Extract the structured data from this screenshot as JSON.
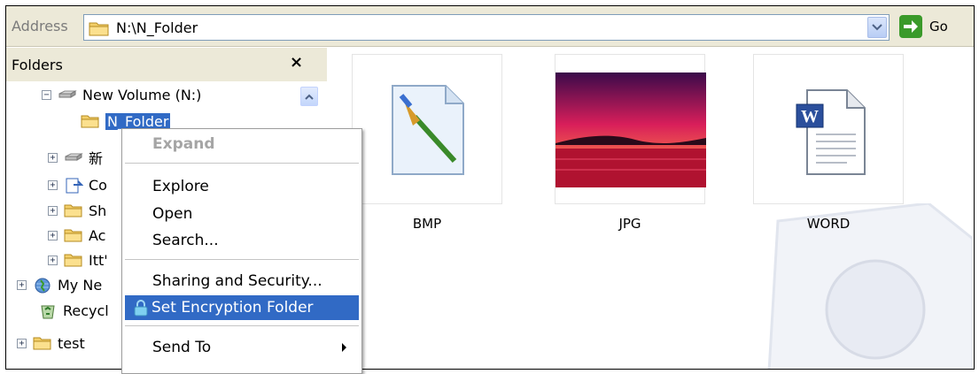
{
  "address": {
    "label": "Address",
    "path": "N:\\N_Folder",
    "go_label": "Go"
  },
  "folders_pane": {
    "title": "Folders",
    "close": "×"
  },
  "tree": [
    {
      "expander": "−",
      "icon": "drive-icon",
      "label": "New Volume (N:)"
    },
    {
      "expander": "",
      "icon": "folder-icon",
      "label": "N_Folder"
    },
    {
      "expander": "+",
      "icon": "drive-icon",
      "label": "新"
    },
    {
      "expander": "+",
      "icon": "control-panel-icon",
      "label": "Co"
    },
    {
      "expander": "+",
      "icon": "folder-icon",
      "label": "Sh"
    },
    {
      "expander": "+",
      "icon": "folder-icon",
      "label": "Ac"
    },
    {
      "expander": "+",
      "icon": "folder-icon",
      "label": "Itt'"
    },
    {
      "expander": "+",
      "icon": "network-icon",
      "label": "My Ne"
    },
    {
      "expander": "",
      "icon": "recycle-bin-icon",
      "label": "Recycl"
    },
    {
      "expander": "+",
      "icon": "folder-icon",
      "label": "test"
    }
  ],
  "files": [
    {
      "label": "BMP",
      "icon": "paint-bitmap-icon"
    },
    {
      "label": "JPG",
      "icon": "sunset-photo-thumbnail"
    },
    {
      "label": "WORD",
      "icon": "word-document-icon"
    }
  ],
  "context_menu": {
    "expand": "Expand",
    "explore": "Explore",
    "open": "Open",
    "search": "Search...",
    "sharing": "Sharing and Security...",
    "encrypt": "Set Encryption Folder",
    "send_to": "Send To"
  },
  "colors": {
    "selection": "#316ac5",
    "toolbar": "#ece9d8",
    "go_green": "#3a9a2a"
  }
}
